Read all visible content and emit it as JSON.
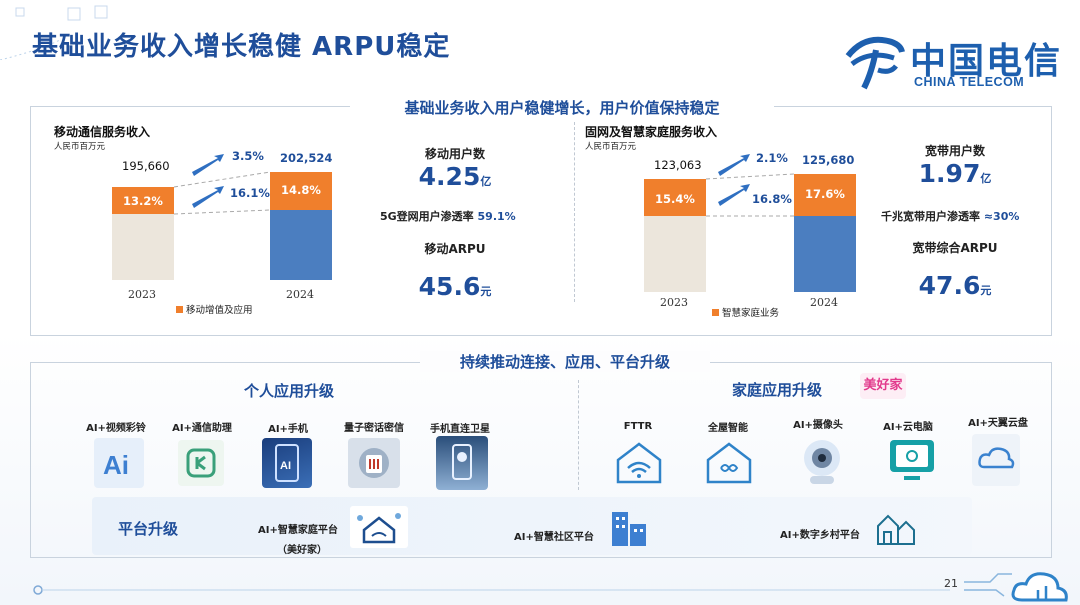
{
  "slide": {
    "title": "基础业务收入增长稳健 ARPU稳定",
    "page_number": "21"
  },
  "logo": {
    "cn": "中国电信",
    "en": "CHINA TELECOM"
  },
  "top_banner": "基础业务收入用户稳健增长，用户价值保持稳定",
  "mobile": {
    "title": "移动通信服务收入",
    "unit": "人民币百万元",
    "years": [
      "2023",
      "2024"
    ],
    "totals": [
      "195,660",
      "202,524"
    ],
    "share_labels": [
      "13.2%",
      "14.8%"
    ],
    "growth_total": "3.5%",
    "growth_segment": "16.1%",
    "legend": "移动增值及应用",
    "stats": {
      "users_label": "移动用户数",
      "users_value": "4.25",
      "users_unit": "亿",
      "penetration_label": "5G登网用户渗透率",
      "penetration_value": "59.1%",
      "arpu_label": "移动ARPU",
      "arpu_value": "45.6",
      "arpu_unit": "元"
    }
  },
  "fixed": {
    "title": "固网及智慧家庭服务收入",
    "unit": "人民币百万元",
    "years": [
      "2023",
      "2024"
    ],
    "totals": [
      "123,063",
      "125,680"
    ],
    "share_labels": [
      "15.4%",
      "17.6%"
    ],
    "growth_total": "2.1%",
    "growth_segment": "16.8%",
    "legend": "智慧家庭业务",
    "stats": {
      "users_label": "宽带用户数",
      "users_value": "1.97",
      "users_unit": "亿",
      "penetration_label": "千兆宽带用户渗透率",
      "penetration_value": "≈30%",
      "arpu_label": "宽带综合ARPU",
      "arpu_value": "47.6",
      "arpu_unit": "元"
    }
  },
  "bottom_banner": "持续推动连接、应用、平台升级",
  "personal": {
    "title": "个人应用升级",
    "apps": [
      "AI+视频彩铃",
      "AI+通信助理",
      "AI+手机",
      "量子密话密信",
      "手机直连卫星"
    ]
  },
  "home": {
    "title": "家庭应用升级",
    "badge": "美好家",
    "apps": [
      "FTTR",
      "全屋智能",
      "AI+摄像头",
      "AI+云电脑",
      "AI+天翼云盘"
    ]
  },
  "platform": {
    "title": "平台升级",
    "items": [
      "AI+智慧家庭平台",
      "AI+智慧社区平台",
      "AI+数字乡村平台"
    ],
    "sub_note": "（美好家）"
  },
  "chart_data": [
    {
      "type": "bar",
      "title": "移动通信服务收入",
      "ylabel": "人民币百万元",
      "categories": [
        "2023",
        "2024"
      ],
      "totals": [
        195660,
        202524
      ],
      "series": [
        {
          "name": "移动增值及应用",
          "share_percent": [
            13.2,
            14.8
          ]
        }
      ],
      "growth": {
        "total": "3.5%",
        "移动增值及应用": "16.1%"
      },
      "colors": {
        "base_2023": "#ece6dc",
        "base_2024": "#4b7ec0",
        "segment": "#f07f2c"
      }
    },
    {
      "type": "bar",
      "title": "固网及智慧家庭服务收入",
      "ylabel": "人民币百万元",
      "categories": [
        "2023",
        "2024"
      ],
      "totals": [
        123063,
        125680
      ],
      "series": [
        {
          "name": "智慧家庭业务",
          "share_percent": [
            15.4,
            17.6
          ]
        }
      ],
      "growth": {
        "total": "2.1%",
        "智慧家庭业务": "16.8%"
      },
      "colors": {
        "base_2023": "#ece6dc",
        "base_2024": "#4b7ec0",
        "segment": "#f07f2c"
      }
    }
  ],
  "colors": {
    "brand_blue": "#1f4e9a",
    "orange": "#f07f2c",
    "bar_blue": "#4b7ec0",
    "beige": "#ece6dc"
  }
}
